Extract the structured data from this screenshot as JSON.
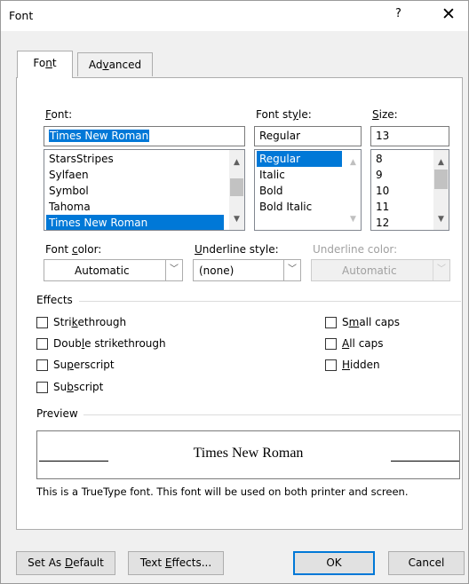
{
  "dialog": {
    "title": "Font",
    "help": "?",
    "close": "✕"
  },
  "tabs": [
    {
      "pre": "Fo",
      "key": "n",
      "post": "t"
    },
    {
      "pre": "Ad",
      "key": "v",
      "post": "anced"
    }
  ],
  "font": {
    "label_key": "F",
    "label_rest": "ont:",
    "value": "Times New Roman",
    "list": [
      "StarsStripes",
      "Sylfaen",
      "Symbol",
      "Tahoma",
      "Times New Roman"
    ],
    "selected": "Times New Roman"
  },
  "font_style": {
    "label_pre": "Font st",
    "label_key": "y",
    "label_post": "le:",
    "value": "Regular",
    "list": [
      "Regular",
      "Italic",
      "Bold",
      "Bold Italic"
    ],
    "selected": "Regular"
  },
  "size": {
    "label_key": "S",
    "label_rest": "ize:",
    "value": "13",
    "list": [
      "8",
      "9",
      "10",
      "11",
      "12"
    ]
  },
  "font_color": {
    "label_pre": "Font ",
    "label_key": "c",
    "label_post": "olor:",
    "value": "Automatic"
  },
  "underline_style": {
    "label_key": "U",
    "label_rest": "nderline style:",
    "value": "(none)"
  },
  "underline_color": {
    "label": "Underline color:",
    "value": "Automatic",
    "enabled": false
  },
  "effects": {
    "title": "Effects",
    "left": [
      {
        "pre": "Stri",
        "key": "k",
        "post": "ethrough",
        "checked": false
      },
      {
        "pre": "Doub",
        "key": "l",
        "post": "e strikethrough",
        "checked": false
      },
      {
        "pre": "Su",
        "key": "p",
        "post": "erscript",
        "checked": false
      },
      {
        "pre": "Su",
        "key": "b",
        "post": "script",
        "checked": false
      }
    ],
    "right": [
      {
        "pre": "S",
        "key": "m",
        "post": "all caps",
        "checked": false
      },
      {
        "pre": "",
        "key": "A",
        "post": "ll caps",
        "checked": false
      },
      {
        "pre": "",
        "key": "H",
        "post": "idden",
        "checked": false
      }
    ]
  },
  "preview": {
    "title": "Preview",
    "sample": "Times New Roman",
    "note": "This is a TrueType font. This font will be used on both printer and screen."
  },
  "buttons": {
    "set_default": {
      "pre": "Set As ",
      "key": "D",
      "post": "efault"
    },
    "text_effects": {
      "pre": "Text ",
      "key": "E",
      "post": "ffects..."
    },
    "ok": "OK",
    "cancel": "Cancel"
  },
  "colors": {
    "selection": "#0078d7",
    "dialog_bg": "#f0f0f0",
    "default_button_border": "#0078d7"
  },
  "icons": {
    "scroll_up": "chevron-up-icon",
    "scroll_down": "chevron-down-icon",
    "combo_drop": "chevron-down-icon"
  }
}
